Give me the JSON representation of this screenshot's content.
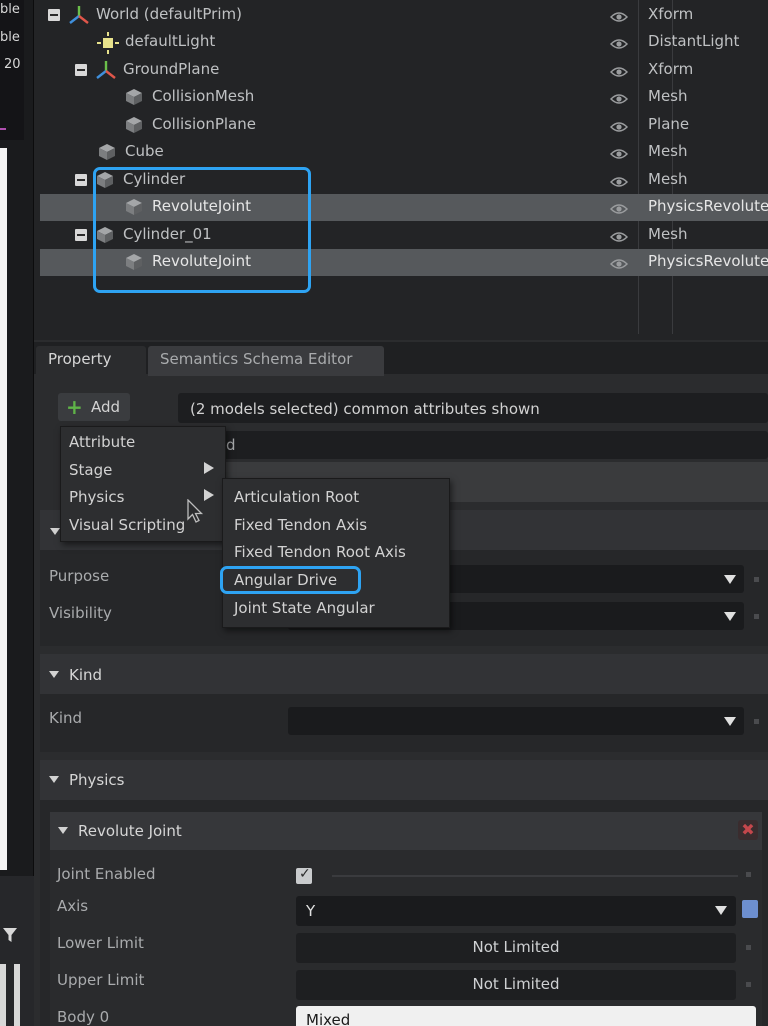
{
  "left_strip": {
    "lines": [
      "ble",
      "ble",
      "20"
    ]
  },
  "stage_tree": {
    "rows": [
      {
        "name": "World (defaultPrim)",
        "type": "Xform",
        "selected": false,
        "icon": "xform-axes-icon"
      },
      {
        "name": "defaultLight",
        "type": "DistantLight",
        "selected": false,
        "icon": "light-icon"
      },
      {
        "name": "GroundPlane",
        "type": "Xform",
        "selected": false,
        "icon": "xform-axes-icon"
      },
      {
        "name": "CollisionMesh",
        "type": "Mesh",
        "selected": false,
        "icon": "mesh-cube-icon"
      },
      {
        "name": "CollisionPlane",
        "type": "Plane",
        "selected": false,
        "icon": "mesh-cube-icon"
      },
      {
        "name": "Cube",
        "type": "Mesh",
        "selected": false,
        "icon": "mesh-cube-icon"
      },
      {
        "name": "Cylinder",
        "type": "Mesh",
        "selected": false,
        "icon": "mesh-cube-icon"
      },
      {
        "name": "RevoluteJoint",
        "type": "PhysicsRevolute",
        "selected": true,
        "icon": "mesh-cube-icon"
      },
      {
        "name": "Cylinder_01",
        "type": "Mesh",
        "selected": false,
        "icon": "mesh-cube-icon"
      },
      {
        "name": "RevoluteJoint",
        "type": "PhysicsRevolute",
        "selected": true,
        "icon": "mesh-cube-icon"
      }
    ]
  },
  "tabs": {
    "property": "Property",
    "semantics": "Semantics Schema Editor"
  },
  "toolbar": {
    "add_label": "Add",
    "models_label": "(2 models selected) common attributes shown",
    "search_tail": "d"
  },
  "add_menu": {
    "items": [
      {
        "label": "Attribute",
        "has_submenu": false
      },
      {
        "label": "Stage",
        "has_submenu": true
      },
      {
        "label": "Physics",
        "has_submenu": true
      },
      {
        "label": "Visual Scripting",
        "has_submenu": false
      }
    ]
  },
  "physics_submenu": {
    "items": [
      "Articulation Root",
      "Fixed Tendon Axis",
      "Fixed Tendon Root Axis",
      "Angular Drive",
      "Joint State Angular"
    ],
    "highlighted": "Angular Drive"
  },
  "sections": {
    "purpose_label": "Purpose",
    "visibility_label": "Visibility",
    "kind_title": "Kind",
    "kind_label": "Kind",
    "physics_title": "Physics"
  },
  "revolute_joint": {
    "title": "Revolute Joint",
    "close": "✖",
    "joint_enabled_label": "Joint Enabled",
    "joint_enabled_checked": true,
    "axis_label": "Axis",
    "axis_value": "Y",
    "lower_limit_label": "Lower Limit",
    "lower_limit_value": "Not Limited",
    "upper_limit_label": "Upper Limit",
    "upper_limit_value": "Not Limited",
    "body0_label": "Body 0",
    "body0_value": "Mixed"
  },
  "colors": {
    "highlight": "#2ea3f2",
    "selected_row": "#56595c",
    "add_plus": "#5fb348",
    "close_x": "#c4474c",
    "axis_color": "#6d8fcf"
  }
}
